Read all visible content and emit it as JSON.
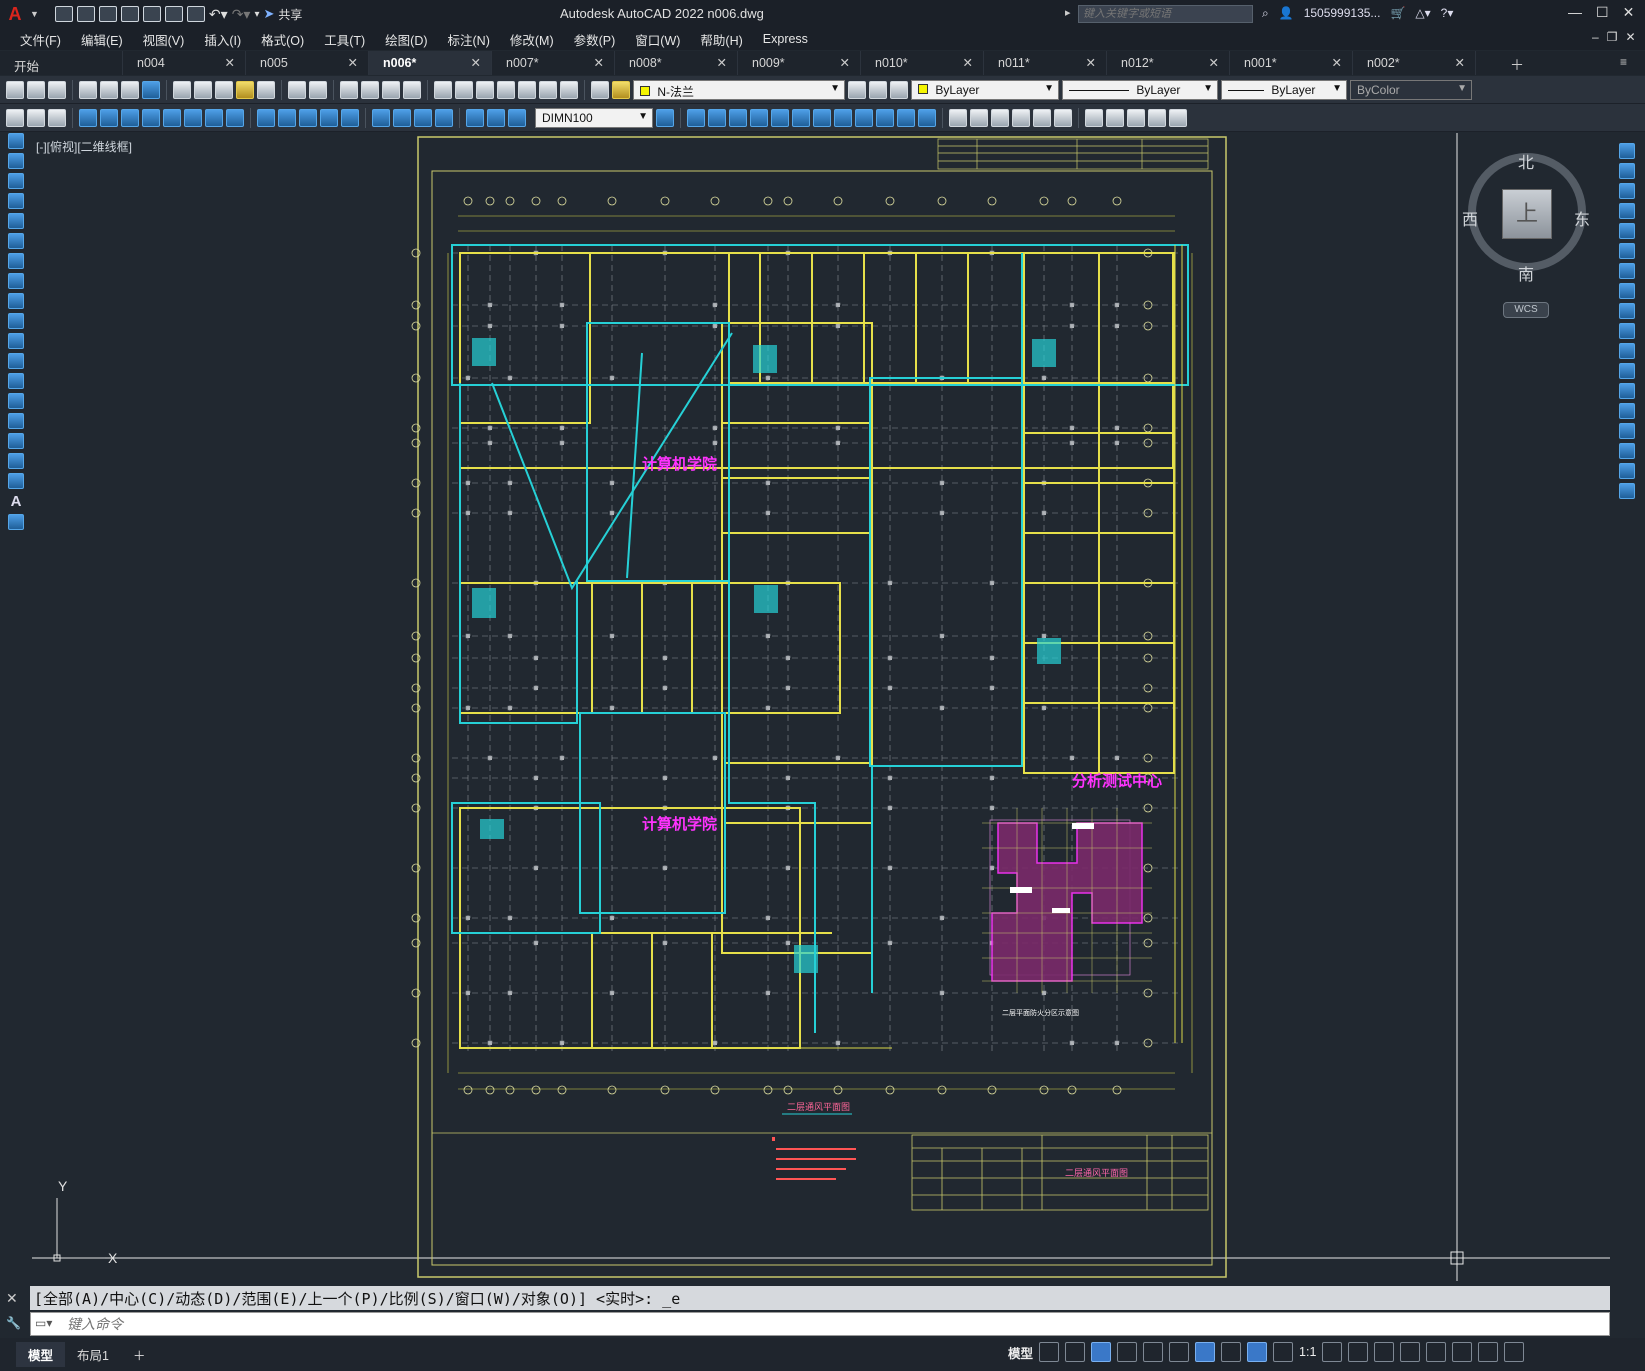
{
  "app": {
    "title": "Autodesk AutoCAD 2022    n006.dwg",
    "share_label": "共享",
    "logo": "A"
  },
  "search": {
    "placeholder": "键入关键字或短语"
  },
  "user": {
    "name": "1505999135..."
  },
  "menu": [
    "文件(F)",
    "编辑(E)",
    "视图(V)",
    "插入(I)",
    "格式(O)",
    "工具(T)",
    "绘图(D)",
    "标注(N)",
    "修改(M)",
    "参数(P)",
    "窗口(W)",
    "帮助(H)",
    "Express"
  ],
  "tabs": [
    {
      "label": "开始",
      "closable": false
    },
    {
      "label": "n004",
      "closable": true
    },
    {
      "label": "n005",
      "closable": true
    },
    {
      "label": "n006*",
      "closable": true,
      "active": true
    },
    {
      "label": "n007*",
      "closable": true
    },
    {
      "label": "n008*",
      "closable": true
    },
    {
      "label": "n009*",
      "closable": true
    },
    {
      "label": "n010*",
      "closable": true
    },
    {
      "label": "n011*",
      "closable": true
    },
    {
      "label": "n012*",
      "closable": true
    },
    {
      "label": "n001*",
      "closable": true
    },
    {
      "label": "n002*",
      "closable": true
    }
  ],
  "toolbar": {
    "layer": "N-法兰",
    "color": "ByLayer",
    "linetype": "ByLayer",
    "lineweight": "ByLayer",
    "plotstyle": "ByColor",
    "dimstyle": "DIMN100"
  },
  "viewport": {
    "label": "[-][俯视][二维线框]"
  },
  "viewcube": {
    "north": "北",
    "south": "南",
    "east": "东",
    "west": "西",
    "face": "上",
    "wcs": "WCS"
  },
  "ucs": {
    "x": "X",
    "y": "Y"
  },
  "drawing": {
    "room_label_1": "计算机学院",
    "room_label_2": "计算机学院",
    "room_label_3": "分析测试中心",
    "plan_title": "二层通风平面图",
    "inset_title": "二层平面防火分区示意图",
    "titleblock_name": "二层通风平面图"
  },
  "command": {
    "history": "[全部(A)/中心(C)/动态(D)/范围(E)/上一个(P)/比例(S)/窗口(W)/对象(O)] <实时>: _e",
    "placeholder": "键入命令"
  },
  "status": {
    "model_tab": "模型",
    "layout_tab": "布局1",
    "model_label": "模型",
    "scale": "1:1"
  },
  "colors": {
    "background": "#212830",
    "cyan": "#26d0d6",
    "yellow": "#e6e04a",
    "magenta": "#ff33ff",
    "border": "#c9c96b"
  }
}
